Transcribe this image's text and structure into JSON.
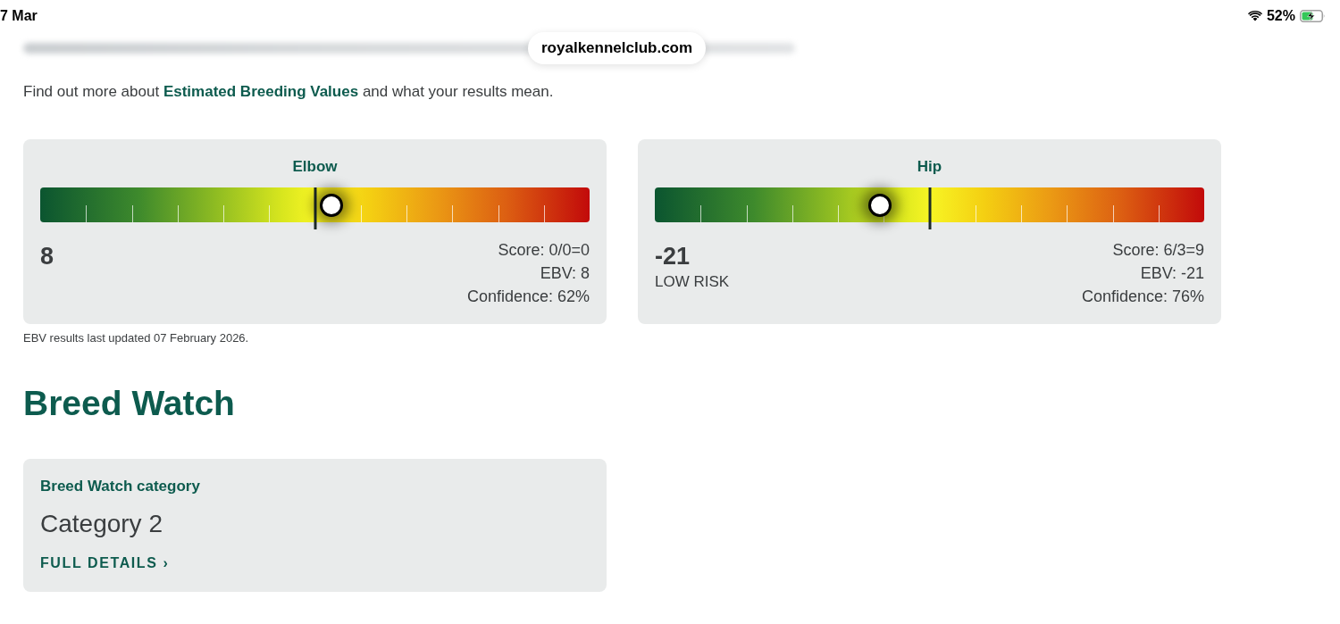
{
  "status_bar": {
    "date": "7 Mar",
    "battery": "52%"
  },
  "address_bar": {
    "url": "royalkennelclub.com"
  },
  "intro": {
    "before": "Find out more about",
    "link": "Estimated Breeding Values",
    "after": "and what your results mean."
  },
  "scores": [
    {
      "title": "Elbow",
      "level": 0.53,
      "value": "8",
      "stats": [
        "Score: 0/0=0",
        "EBV: 8",
        "Confidence: 62%"
      ]
    },
    {
      "title": "Hip",
      "level": 0.41,
      "value": "-21",
      "risk": "LOW RISK",
      "stats": [
        "Score: 6/3=9",
        "EBV: -21",
        "Confidence: 76%"
      ]
    }
  ],
  "updated_note": "EBV results last updated 07 February 2026.",
  "breed_watch": {
    "heading": "Breed Watch",
    "label": "Breed Watch category",
    "category": "Category 2",
    "link": "FULL DETAILS ›"
  }
}
